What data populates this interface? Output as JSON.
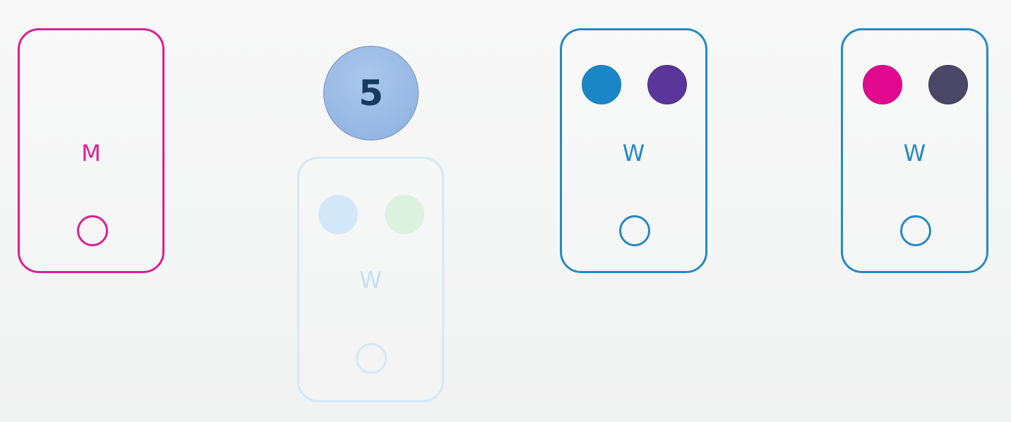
{
  "colors": {
    "master_border": "#d91f93",
    "worker_border": "#2389c5",
    "faded_border": "#d4e8f8",
    "faded_text": "#c6def3",
    "badge_text": "#173a5e"
  },
  "master_node": {
    "label": "M"
  },
  "badge": {
    "value": "5"
  },
  "new_worker_node": {
    "label": "W",
    "state": "fading-in",
    "pods": [
      {
        "color": "#d3e7f9",
        "icon": "pod-dot"
      },
      {
        "color": "#dcf1df",
        "icon": "pod-dot"
      }
    ]
  },
  "worker_nodes": [
    {
      "label": "W",
      "pods": [
        {
          "color": "#1a86c6",
          "icon": "pod-dot"
        },
        {
          "color": "#5a369a",
          "icon": "pod-dot"
        }
      ]
    },
    {
      "label": "W",
      "pods": [
        {
          "color": "#e0088f",
          "icon": "pod-dot"
        },
        {
          "color": "#4a4766",
          "icon": "pod-dot"
        }
      ]
    }
  ]
}
